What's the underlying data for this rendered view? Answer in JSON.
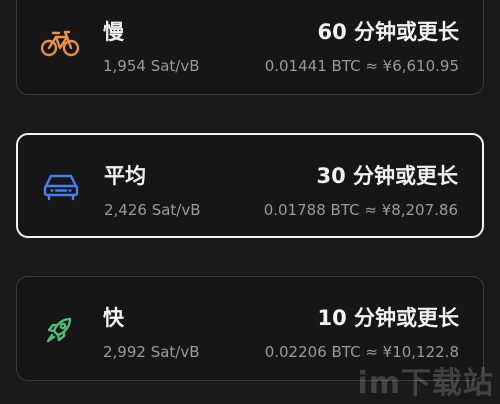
{
  "options": [
    {
      "label": "慢",
      "rate": "1,954 Sat/vB",
      "time": "60 分钟或更长",
      "fee": "0.01441 BTC ≈ ¥6,610.95",
      "icon": "bicycle-icon",
      "icon_color": "#e8914a",
      "selected": false
    },
    {
      "label": "平均",
      "rate": "2,426 Sat/vB",
      "time": "30 分钟或更长",
      "fee": "0.01788 BTC ≈ ¥8,207.86",
      "icon": "car-icon",
      "icon_color": "#4a7ff0",
      "selected": true
    },
    {
      "label": "快",
      "rate": "2,992 Sat/vB",
      "time": "10 分钟或更长",
      "fee": "0.02206 BTC ≈ ¥10,122.8",
      "icon": "rocket-icon",
      "icon_color": "#4fbf7a",
      "selected": false
    }
  ],
  "watermark": "im下载站"
}
